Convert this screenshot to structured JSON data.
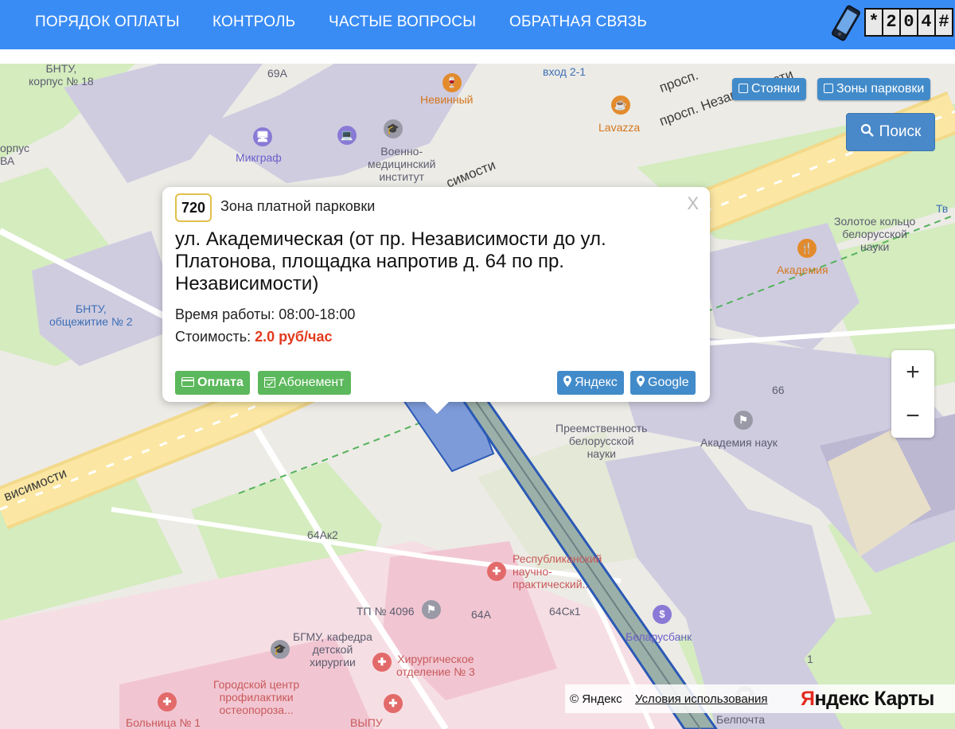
{
  "nav": {
    "items": [
      "ПОРЯДОК ОПЛАТЫ",
      "КОНТРОЛЬ",
      "ЧАСТЫЕ ВОПРОСЫ",
      "ОБРАТНАЯ СВЯЗЬ"
    ],
    "phone_code": [
      "*",
      "2",
      "0",
      "4",
      "#"
    ]
  },
  "map": {
    "layer_buttons": {
      "parking": "Стоянки",
      "zones": "Зоны парковки"
    },
    "search_label": "Поиск",
    "zoom_in": "+",
    "zoom_out": "−",
    "labels": {
      "bntu18": "БНТУ,\nкорпус № 18",
      "b69a": "69А",
      "entrance": "вход 2-1",
      "nevinny": "Невинный",
      "lavazza": "Lavazza",
      "prosp1": "просп.",
      "prosp2": "просп. Независимости",
      "korpus_left": "орпус\nВА",
      "mikgraf": "Микграф",
      "voen": "Военно-\nмедицинский\nинститут",
      "road_mid": "симости",
      "zolotoe": "Золотое кольцо\nбелорусской\nнауки",
      "tv": "Тв",
      "akademiya": "Академия",
      "bntu_obsch": "БНТУ,\nобщежитие № 2",
      "road_left": "висимости",
      "b66": "66",
      "preemstv": "Преемственность\nбелорусской\nнауки",
      "akad_nauk": "Академия наук",
      "b64ak2": "64Ак2",
      "resp": "Республиканский\nнаучно-\nпрактический...",
      "tp4096": "ТП № 4096",
      "b64a": "64А",
      "b64sk1": "64Ск1",
      "belarusbank": "Беларусбанк",
      "bgmu": "БГМУ, кафедра\nдетской\nхирургии",
      "hirurg": "Хирургическое\nотделение № 3",
      "gorod": "Городской центр\nпрофилактики\nостеопороза...",
      "b1": "1",
      "bolnica": "Больница № 1",
      "vypu": "ВЫПУ",
      "belpochta": "Белпочта"
    }
  },
  "popup": {
    "zone_number": "720",
    "zone_title": "Зона платной парковки",
    "close": "X",
    "address": "ул. Академическая (от пр. Независимости до ул. Платонова, площадка напротив д. 64 по пр. Независимости)",
    "hours_label": "Время работы: 08:00-18:00",
    "cost_label": "Стоимость: ",
    "cost_value": "2.0 руб/час",
    "buttons": {
      "pay": "Оплата",
      "subscription": "Абонемент",
      "yandex": "Яндекс",
      "google": "Google"
    }
  },
  "attribution": {
    "copyright": "© Яндекс",
    "terms": "Условия использования",
    "brand_y": "Я",
    "brand_rest": "ндекс Карты"
  },
  "colors": {
    "nav_bg": "#3a8cf5",
    "accent_blue": "#428bca",
    "green_button": "#5cb85c",
    "price_red": "#e23a1c",
    "zone_highlight": "#7d9bd9"
  }
}
